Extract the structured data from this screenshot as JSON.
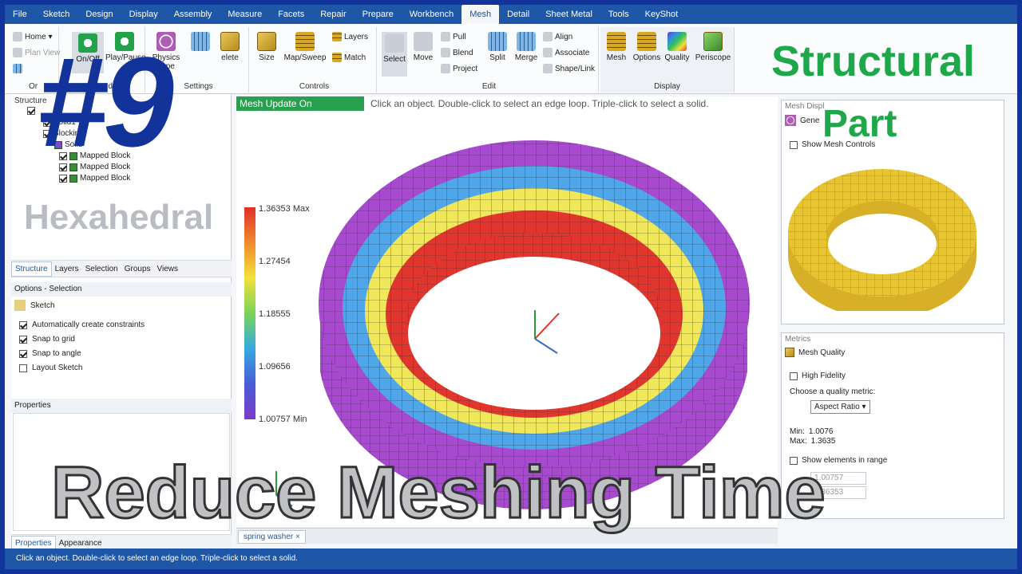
{
  "menubar": {
    "items": [
      "File",
      "Sketch",
      "Design",
      "Display",
      "Assembly",
      "Measure",
      "Facets",
      "Repair",
      "Prepare",
      "Workbench",
      "Mesh",
      "Detail",
      "Sheet Metal",
      "Tools",
      "KeyShot"
    ],
    "active_index": 10
  },
  "ribbon": {
    "orient_label": "Or",
    "home": "Home ▾",
    "plan_view": "Plan View",
    "on_off": "On/Off",
    "play_pause": "Play/Pause",
    "update_label": "date",
    "physics_type": "Physics\nType",
    "delete": "elete",
    "settings_label": "Settings",
    "size": "Size",
    "map_sweep": "Map/Sweep",
    "layers": "Layers",
    "match": "Match",
    "controls_label": "Controls",
    "select": "Select",
    "move": "Move",
    "pull": "Pull",
    "blend": "Blend",
    "project": "Project",
    "split": "Split",
    "merge": "Merge",
    "align": "Align",
    "associate": "Associate",
    "shape_link": "Shape/Link",
    "edit_label": "Edit",
    "mesh": "Mesh",
    "options": "Options",
    "quality": "Quality",
    "periscope": "Periscope",
    "display_label": "Display"
  },
  "structure": {
    "title": "Structure",
    "items": [
      "Solid1",
      "Blocking",
      "Solid",
      "Mapped Block",
      "Mapped Block",
      "Mapped Block"
    ],
    "tabs": [
      "Structure",
      "Layers",
      "Selection",
      "Groups",
      "Views"
    ]
  },
  "options": {
    "title": "Options - Selection",
    "sketch": "Sketch",
    "checks": [
      {
        "label": "Automatically create constraints",
        "checked": true
      },
      {
        "label": "Snap to grid",
        "checked": true
      },
      {
        "label": "Snap to angle",
        "checked": true
      },
      {
        "label": "Layout Sketch",
        "checked": false
      }
    ]
  },
  "properties": {
    "title": "Properties",
    "tabs": [
      "Properties",
      "Appearance"
    ]
  },
  "viewport": {
    "mesh_update": "Mesh Update On",
    "hint": "Click an object. Double-click to select an edge loop. Triple-click to select a solid.",
    "legend": [
      "1.36353 Max",
      "1.27454",
      "1.18555",
      "1.09656",
      "1.00757 Min"
    ],
    "doc_tab": "spring washer ×"
  },
  "right_panel": {
    "mesh_display_title": "Mesh Displ",
    "general": "Gene",
    "show_mesh_controls": "Show Mesh Controls",
    "metrics_title": "Metrics",
    "mesh_quality": "Mesh Quality",
    "high_fidelity": "High Fidelity",
    "choose_metric": "Choose a quality metric:",
    "metric_value": "Aspect Ratio ▾",
    "min_label": "Min:",
    "min_value": "1.0076",
    "max_label": "Max:",
    "max_value": "1.3635",
    "show_range": "Show elements in range",
    "range_min": "1.00757",
    "range_max": "1.36353"
  },
  "statusbar": {
    "text": "Click an object. Double-click to select an edge loop. Triple-click to select a solid."
  },
  "overlay": {
    "title": "Structural",
    "title2": "Part",
    "hex": "Hexahedral",
    "reduce": "Reduce Meshing Time",
    "number": "#9"
  },
  "colors": {
    "accent": "#1e56a8",
    "green": "#1ea84a",
    "mesh_update": "#28a050"
  }
}
